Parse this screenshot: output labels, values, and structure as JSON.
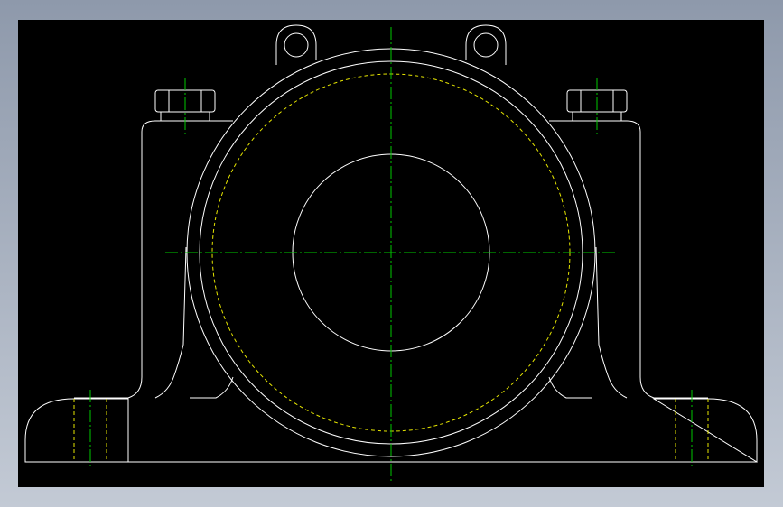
{
  "drawing": {
    "name": "plummer-block-pillow-housing-front-view",
    "colors": {
      "background": "#000000",
      "outline": "#ffffff",
      "centerline": "#00c800",
      "hidden": "#e6e600",
      "window_gradient_top": "#8e99ab",
      "window_gradient_bottom": "#c3cad5"
    }
  }
}
